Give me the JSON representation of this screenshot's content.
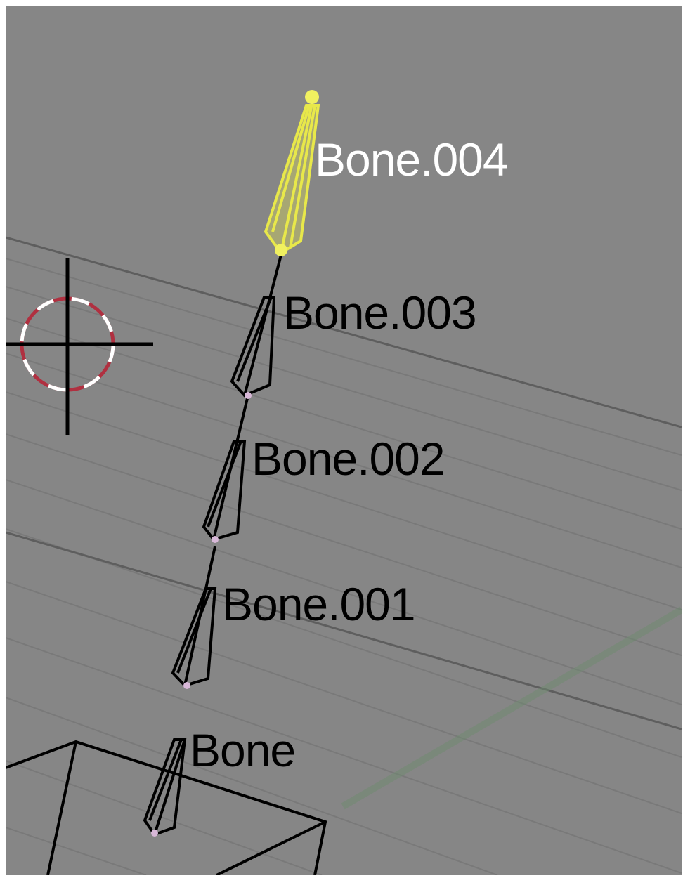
{
  "viewport": {
    "background": "#868686",
    "grid_color": "#7a7a7a",
    "label_color": "#000000",
    "selected_label_color": "#ffffff",
    "selected_bone_color": "#e8e84a"
  },
  "bones": [
    {
      "name": "Bone.004",
      "selected": true
    },
    {
      "name": "Bone.003",
      "selected": false
    },
    {
      "name": "Bone.002",
      "selected": false
    },
    {
      "name": "Bone.001",
      "selected": false
    },
    {
      "name": "Bone",
      "selected": false
    }
  ],
  "cursor": {
    "icon": "3d-cursor-icon"
  }
}
